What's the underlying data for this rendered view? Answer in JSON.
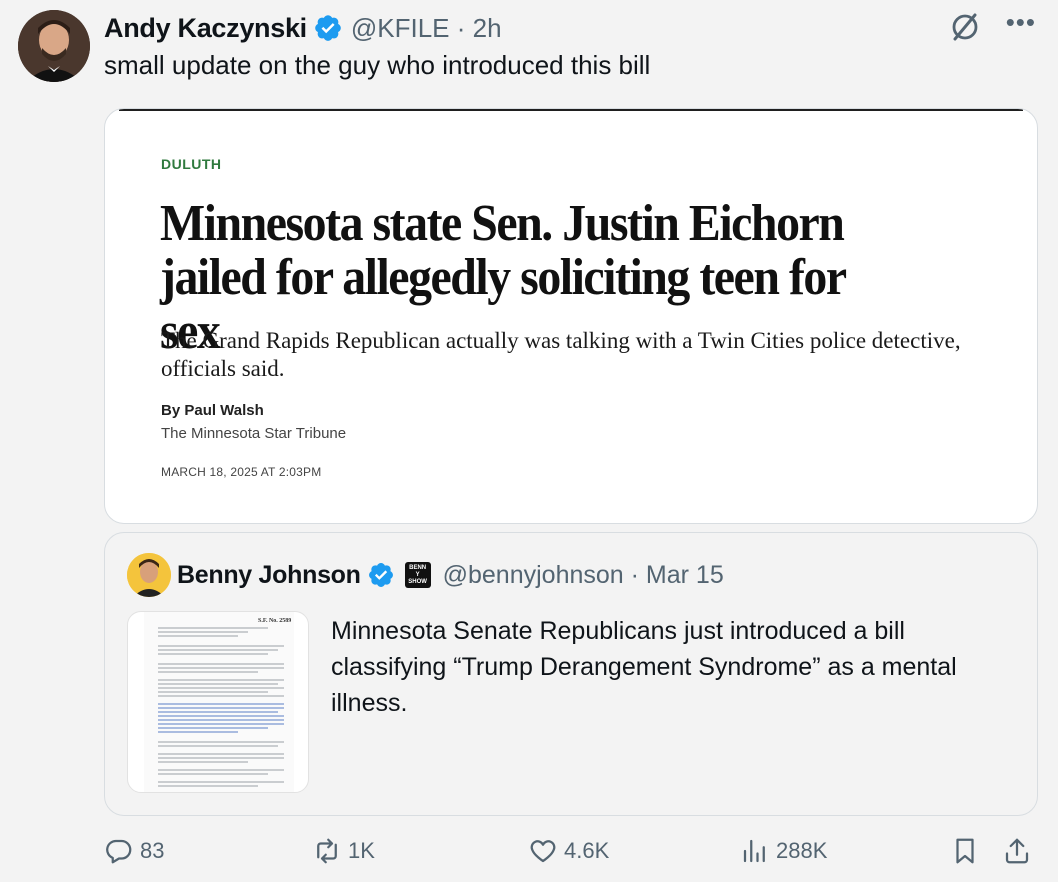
{
  "tweet": {
    "author_name": "Andy Kaczynski",
    "handle_time": "@KFILE · 2h",
    "text": "small update on the guy who introduced this bill"
  },
  "article": {
    "section": "DULUTH",
    "headline": "Minnesota state Sen. Justin Eichorn jailed for allegedly soliciting teen for sex",
    "dek": "The Grand Rapids Republican actually was talking with a Twin Cities police detective, officials said.",
    "byline": "By Paul Walsh",
    "outlet": "The Minnesota Star Tribune",
    "date": "MARCH 18, 2025 AT 2:03PM"
  },
  "quoted": {
    "author_name": "Benny Johnson",
    "badge_text": "BENNY SHOW",
    "handle_time": "@bennyjohnson · Mar 15",
    "text": "Minnesota Senate Republicans  just introduced a bill classifying “Trump Derangement Syndrome” as a mental illness.",
    "thumb_header": "S.F. No. 2589"
  },
  "actions": {
    "replies": "83",
    "reposts": "1K",
    "likes": "4.6K",
    "views": "288K"
  },
  "colors": {
    "verified": "#1d9bf0",
    "muted": "#536471",
    "section": "#2f7a3e"
  },
  "icons": [
    "grok-icon",
    "more-icon",
    "verified-icon",
    "reply-icon",
    "repost-icon",
    "like-icon",
    "views-icon",
    "bookmark-icon",
    "share-icon"
  ]
}
